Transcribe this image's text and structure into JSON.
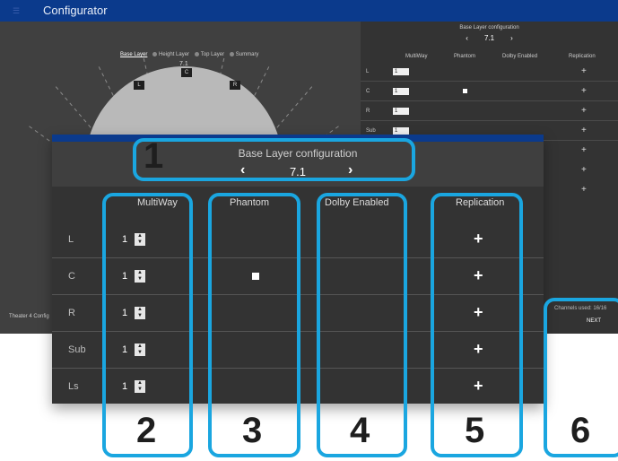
{
  "app": {
    "title": "Configurator",
    "menu_icon": "hamburger-menu-icon"
  },
  "steps": [
    {
      "label": "Base Layer",
      "active": true
    },
    {
      "label": "Height Layer",
      "active": false
    },
    {
      "label": "Top Layer",
      "active": false
    },
    {
      "label": "Summary",
      "active": false
    }
  ],
  "layout_format": "7.1",
  "speakers": [
    "L",
    "C",
    "R"
  ],
  "background_panel": {
    "title": "Base Layer configuration",
    "format": "7.1",
    "prev_icon": "chevron-left-icon",
    "next_icon": "chevron-right-icon",
    "columns": [
      "MultiWay",
      "Phantom",
      "Dolby Enabled",
      "Replication"
    ],
    "rows": [
      {
        "label": "L",
        "multiway": "1",
        "phantom": false
      },
      {
        "label": "C",
        "multiway": "1",
        "phantom": true
      },
      {
        "label": "R",
        "multiway": "1",
        "phantom": false
      },
      {
        "label": "Sub",
        "multiway": "1",
        "phantom": false
      }
    ],
    "channels_used": "Channels used: 16/16",
    "next_label": "NEXT"
  },
  "status_left": "Theater 4 Config",
  "dialog": {
    "title": "Base Layer configuration",
    "format": "7.1",
    "prev_glyph": "‹",
    "next_glyph": "›",
    "columns": [
      "MultiWay",
      "Phantom",
      "Dolby Enabled",
      "Replication"
    ],
    "rows": [
      {
        "label": "L",
        "multiway": "1",
        "phantom": false,
        "plus": "+"
      },
      {
        "label": "C",
        "multiway": "1",
        "phantom": true,
        "plus": "+"
      },
      {
        "label": "R",
        "multiway": "1",
        "phantom": false,
        "plus": "+"
      },
      {
        "label": "Sub",
        "multiway": "1",
        "phantom": false,
        "plus": "+"
      },
      {
        "label": "Ls",
        "multiway": "1",
        "phantom": false,
        "plus": "+"
      }
    ]
  },
  "callouts": [
    "1",
    "2",
    "3",
    "4",
    "5",
    "6"
  ],
  "colors": {
    "accent": "#1aa6e0",
    "titlebar": "#0b3a8c",
    "panel": "#333333"
  }
}
